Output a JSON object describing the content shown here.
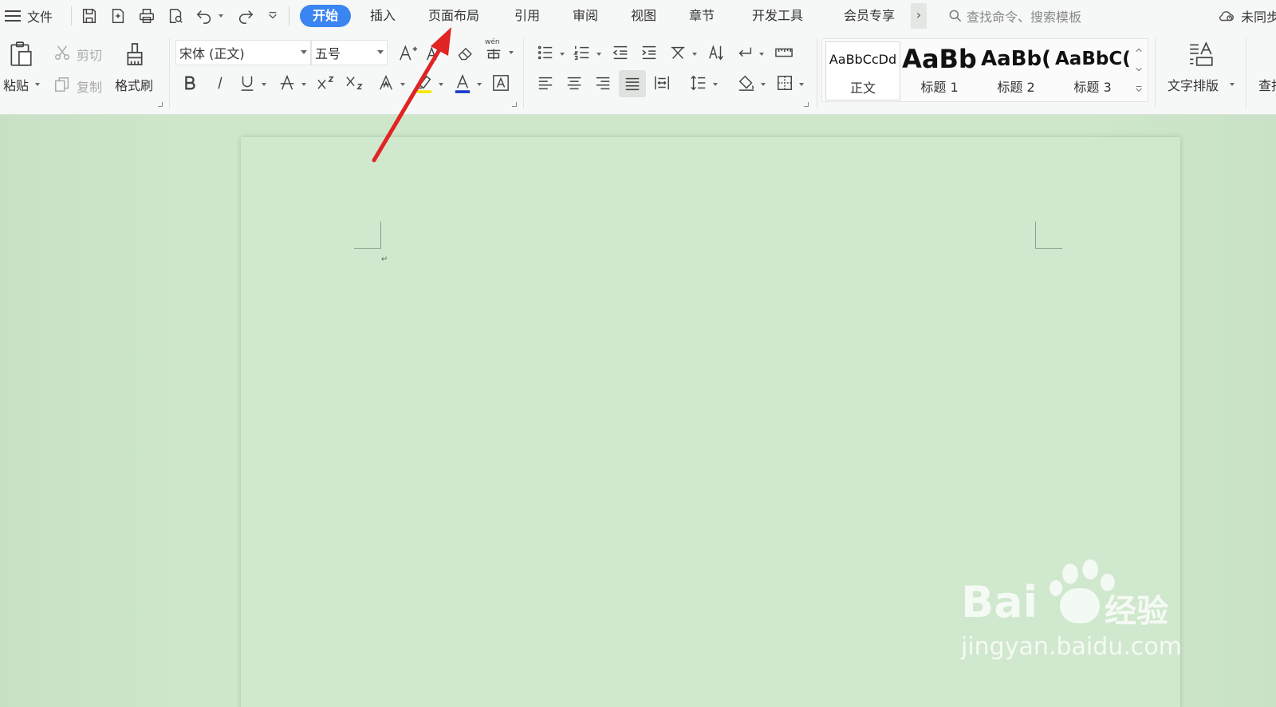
{
  "menu": {
    "file_label": "文件",
    "tabs": [
      {
        "label": "开始",
        "active": true
      },
      {
        "label": "插入",
        "active": false
      },
      {
        "label": "页面布局",
        "active": false
      },
      {
        "label": "引用",
        "active": false
      },
      {
        "label": "审阅",
        "active": false
      },
      {
        "label": "视图",
        "active": false
      },
      {
        "label": "章节",
        "active": false
      },
      {
        "label": "开发工具",
        "active": false
      },
      {
        "label": "会员专享",
        "active": false
      }
    ],
    "more_label": "›",
    "search_placeholder": "查找命令、搜索模板",
    "sync_label": "未同步"
  },
  "ribbon": {
    "paste_label": "粘贴",
    "cut_label": "剪切",
    "copy_label": "复制",
    "format_painter_label": "格式刷",
    "font_name": "宋体 (正文)",
    "font_size": "五号",
    "phonetic_glyph": "wén",
    "styles": [
      {
        "sample": "AaBbCcDd",
        "name": "正文"
      },
      {
        "sample": "AaBb",
        "name": "标题 1"
      },
      {
        "sample": "AaBb(",
        "name": "标题 2"
      },
      {
        "sample": "AaBbC(",
        "name": "标题 3"
      }
    ],
    "text_layout_label": "文字排版",
    "find_label": "查找"
  },
  "document": {
    "paragraph_mark": "↵"
  },
  "watermark": {
    "brand": "Bai",
    "brand_suffix": "经验",
    "url": "jingyan.baidu.com"
  },
  "colors": {
    "accent": "#3a85f2",
    "doc_background": "#cee7cb",
    "arrow": "#e02323",
    "highlight": "#f5e800",
    "font_color": "#1a3ec9"
  }
}
